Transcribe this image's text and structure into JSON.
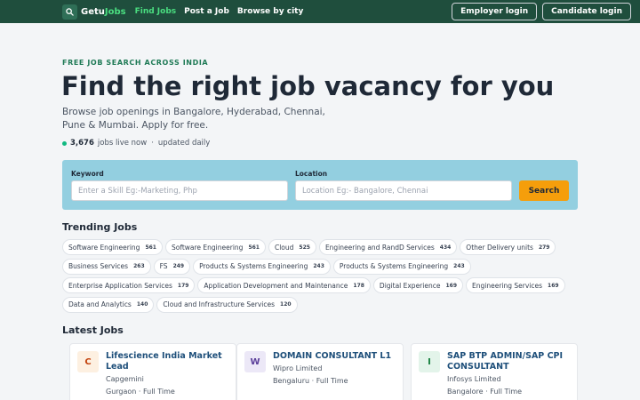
{
  "header": {
    "brand_main": "Getu",
    "brand_accent": "Jobs",
    "nav": [
      {
        "label": "Find Jobs",
        "active": true
      },
      {
        "label": "Post a Job",
        "active": false
      },
      {
        "label": "Browse by city",
        "active": false
      }
    ],
    "employer_login": "Employer login",
    "candidate_login": "Candidate login"
  },
  "hero": {
    "eyebrow": "FREE JOB SEARCH ACROSS INDIA",
    "title": "Find the right job vacancy for you",
    "subtitle": "Browse job openings in Bangalore, Hyderabad, Chennai, Pune & Mumbai. Apply for free.",
    "live_count": "3,676",
    "live_text": "jobs live now",
    "live_sep": "·",
    "live_updated": "updated daily"
  },
  "search": {
    "keyword_label": "Keyword",
    "keyword_placeholder": "Enter a Skill Eg:-Marketing, Php",
    "keyword_value": "",
    "location_label": "Location",
    "location_placeholder": "Location Eg:- Bangalore, Chennai",
    "location_value": "",
    "button": "Search"
  },
  "trending": {
    "title": "Trending Jobs",
    "chips": [
      {
        "label": "Software Engineering",
        "count": "561"
      },
      {
        "label": "Software Engineering",
        "count": "561"
      },
      {
        "label": "Cloud",
        "count": "525"
      },
      {
        "label": "Engineering and RandD Services",
        "count": "434"
      },
      {
        "label": "Other Delivery units",
        "count": "279"
      },
      {
        "label": "Business Services",
        "count": "263"
      },
      {
        "label": "FS",
        "count": "249"
      },
      {
        "label": "Products & Systems Engineering",
        "count": "243"
      },
      {
        "label": "Products & Systems Engineering",
        "count": "243"
      },
      {
        "label": "Enterprise Application Services",
        "count": "179"
      },
      {
        "label": "Application Development and Maintenance",
        "count": "178"
      },
      {
        "label": "Digital Experience",
        "count": "169"
      },
      {
        "label": "Engineering Services",
        "count": "169"
      },
      {
        "label": "Data and Analytics",
        "count": "140"
      },
      {
        "label": "Cloud and Infrastructure Services",
        "count": "120"
      }
    ]
  },
  "latest": {
    "title": "Latest Jobs",
    "cards": [
      {
        "initial": "C",
        "title": "Lifescience India Market Lead",
        "company": "Capgemini",
        "location": "Gurgaon",
        "type": "Full Time",
        "sep": "·",
        "badge_bg": "#fdf0e1",
        "badge_color": "#c2410c"
      },
      {
        "initial": "W",
        "title": "DOMAIN CONSULTANT L1",
        "company": "Wipro Limited",
        "location": "Bengaluru",
        "type": "Full Time",
        "sep": "·",
        "badge_bg": "#ece8f7",
        "badge_color": "#5b3f9a"
      },
      {
        "initial": "I",
        "title": "SAP BTP ADMIN/SAP CPI CONSULTANT",
        "company": "Infosys Limited",
        "location": "Bangalore",
        "type": "Full Time",
        "sep": "·",
        "badge_bg": "#e3f4ea",
        "badge_color": "#15803d"
      }
    ]
  },
  "colors": {
    "header_bg": "#1f4e3d",
    "brand_accent": "#4ade80",
    "search_panel": "#93cfe0",
    "search_button": "#f59e0b",
    "job_title": "#1e4f7a"
  }
}
